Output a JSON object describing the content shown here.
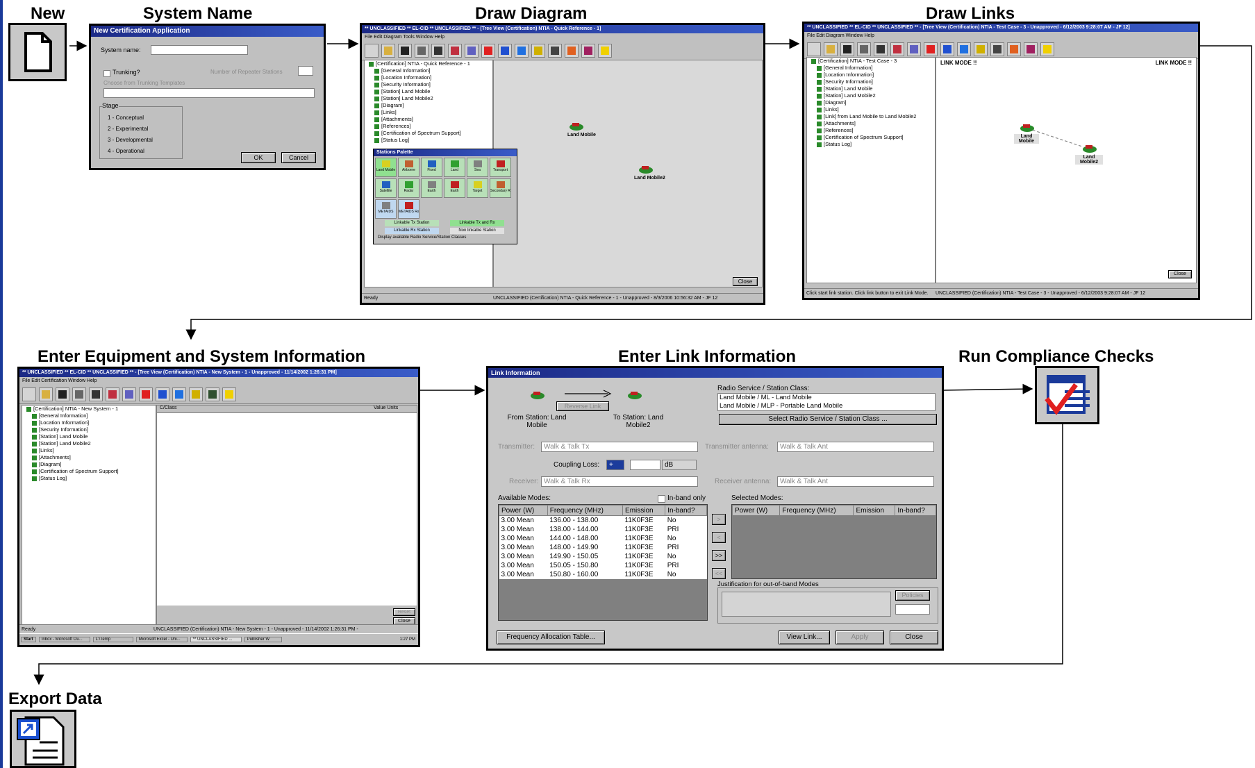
{
  "titles": {
    "new": "New",
    "system_name": "System Name",
    "draw_diagram": "Draw Diagram",
    "draw_links": "Draw Links",
    "enter_equipment": "Enter Equipment and System Information",
    "enter_link": "Enter Link Information",
    "run_compliance": "Run Compliance Checks",
    "export_data": "Export Data"
  },
  "new_cert_dialog": {
    "title": "New Certification Application",
    "system_name_label": "System name:",
    "trunking_label": "Trunking?",
    "repeater_label": "Number of Repeater Stations",
    "template_label": "Choose from Trunking Templates",
    "stage_label": "Stage",
    "stages": [
      "1 - Conceptual",
      "2 - Experimental",
      "3 - Developmental",
      "4 - Operational"
    ],
    "ok": "OK",
    "cancel": "Cancel"
  },
  "draw_diagram": {
    "title": "** UNCLASSIFIED **      EL-CID      ** UNCLASSIFIED ** - [Tree View (Certification) NTIA - Quick Reference - 1]",
    "menu": "File  Edit  Diagram  Tools  Window  Help",
    "tree": [
      "[Certification] NTIA - Quick Reference - 1",
      "[General Information]",
      "[Location Information]",
      "[Security Information]",
      "[Station] Land Mobile",
      "[Station] Land Mobile2",
      "[Diagram]",
      "[Links]",
      "[Attachments]",
      "[References]",
      "[Certification of Spectrum Support]",
      "[Status Log]"
    ],
    "nodes": [
      "Land Mobile",
      "Land Mobile2"
    ],
    "palette_title": "Stations Palette",
    "palette_row1": [
      "Land Mobile",
      "Airborne",
      "Fixed",
      "Land",
      "Sea",
      "Transport"
    ],
    "palette_row2": [
      "Satellite",
      "Radar",
      "Earth",
      "Earth",
      "Target",
      "Secondary Radar"
    ],
    "palette_row3": [
      "METAIDS",
      "METAIDS Radar"
    ],
    "legend": [
      "Linkable Tx Station",
      "Linkable Tx and Rx",
      "Linkable Rx Station",
      "Non linkable Station"
    ],
    "palette_check": "Display available Radio Service/Station Classes",
    "status_left": "Ready",
    "status_right": "UNCLASSIFIED (Certification) NTIA - Quick Reference - 1 - Unapproved - 8/3/2006 10:56:32 AM - JF 12",
    "close": "Close"
  },
  "draw_links": {
    "title": "** UNCLASSIFIED **      EL-CID      ** UNCLASSIFIED ** - [Tree View (Certification) NTIA - Test Case - 3 - Unapproved - 6/12/2003 9:28:07 AM - JF 12]",
    "menu": "File  Edit  Diagram  Window  Help",
    "tree": [
      "[Certification] NTIA - Test Case - 3",
      "[General Information]",
      "[Location Information]",
      "[Security Information]",
      "[Station] Land Mobile",
      "[Station] Land Mobile2",
      "[Diagram]",
      "[Links]",
      "[Link] from Land Mobile to Land Mobile2",
      "[Attachments]",
      "[References]",
      "[Certification of Spectrum Support]",
      "[Status Log]"
    ],
    "link_mode_left": "LINK MODE !!",
    "link_mode_right": "LINK MODE !!",
    "nodes": [
      "Land Mobile",
      "Land Mobile2"
    ],
    "status_left": "Click start link station. Click link button to exit Link Mode.",
    "status_right": "UNCLASSIFIED (Certification) NTIA - Test Case - 3 - Unapproved - 6/12/2003 9:28:07 AM - JF 12",
    "close": "Close"
  },
  "equipment": {
    "title": "** UNCLASSIFIED **      EL-CID      ** UNCLASSIFIED ** - [Tree View (Certification) NTIA - New System - 1 - Unapproved - 11/14/2002 1:26:31 PM]",
    "menu": "File  Edit  Certification  Window  Help",
    "tree": [
      "[Certification] NTIA - New System - 1",
      "[General Information]",
      "[Location Information]",
      "[Security Information]",
      "[Station] Land Mobile",
      "[Station] Land Mobile2",
      "[Links]",
      "[Attachments]",
      "[Diagram]",
      "[Certification of Spectrum Support]",
      "[Status Log]"
    ],
    "grid_col1": "C/Class",
    "grid_col2": "Value Units",
    "reset": "Reset",
    "close": "Close",
    "status_left": "Ready",
    "status_right": "UNCLASSIFIED (Certification) NTIA - New System - 1 - Unapproved - 11/14/2002 1:26:31 PM -",
    "taskbar": [
      "Start",
      "Inbox - Microsoft Ou...",
      "L:\\Temp",
      "Microsoft Excel - Uni...",
      "** UNCLASSIFIED ...",
      "Publisher W"
    ],
    "clock": "1:27 PM"
  },
  "link_info": {
    "title": "Link Information",
    "reverse_link": "Reverse Link",
    "from_station": "From Station: Land Mobile",
    "to_station": "To Station: Land Mobile2",
    "radio_service_label": "Radio Service / Station Class:",
    "radio_services": [
      "Land Mobile / ML - Land Mobile",
      "Land Mobile / MLP - Portable Land Mobile"
    ],
    "select_button": "Select Radio Service / Station Class ...",
    "transmitter_label": "Transmitter:",
    "transmitter_value": "Walk & Talk Tx",
    "tx_antenna_label": "Transmitter antenna:",
    "tx_antenna_value": "Walk & Talk Ant",
    "coupling_label": "Coupling Loss:",
    "coupling_sign": "+",
    "coupling_unit": "dB",
    "receiver_label": "Receiver:",
    "receiver_value": "Walk & Talk Rx",
    "rx_antenna_label": "Receiver antenna:",
    "rx_antenna_value": "Walk & Talk Ant",
    "available_label": "Available Modes:",
    "inband_only": "In-band only",
    "selected_label": "Selected Modes:",
    "columns": [
      "Power (W)",
      "Frequency (MHz)",
      "Emission",
      "In-band?"
    ],
    "rows": [
      [
        "3.00 Mean",
        "136.00 - 138.00",
        "11K0F3E",
        "No"
      ],
      [
        "3.00 Mean",
        "138.00 - 144.00",
        "11K0F3E",
        "PRI"
      ],
      [
        "3.00 Mean",
        "144.00 - 148.00",
        "11K0F3E",
        "No"
      ],
      [
        "3.00 Mean",
        "148.00 - 149.90",
        "11K0F3E",
        "PRI"
      ],
      [
        "3.00 Mean",
        "149.90 - 150.05",
        "11K0F3E",
        "No"
      ],
      [
        "3.00 Mean",
        "150.05 - 150.80",
        "11K0F3E",
        "PRI"
      ],
      [
        "3.00 Mean",
        "150.80 - 160.00",
        "11K0F3E",
        "No"
      ]
    ],
    "move_buttons": [
      ">",
      "<",
      ">>",
      "<<"
    ],
    "justification_label": "Justification for out-of-band Modes",
    "policies": "Policies",
    "freq_table": "Frequency Allocation Table...",
    "view_link": "View Link...",
    "apply": "Apply",
    "close": "Close"
  }
}
